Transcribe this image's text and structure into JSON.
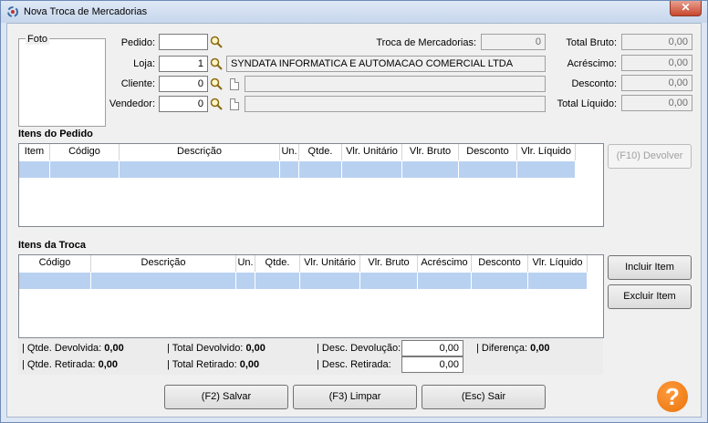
{
  "window": {
    "title": "Nova Troca de Mercadorias",
    "close_label": "✕"
  },
  "foto": {
    "label": "Foto"
  },
  "fields": {
    "pedido": {
      "label": "Pedido:",
      "value": ""
    },
    "loja": {
      "label": "Loja:",
      "value": "1",
      "name": "SYNDATA INFORMATICA E AUTOMACAO COMERCIAL LTDA"
    },
    "cliente": {
      "label": "Cliente:",
      "value": "0",
      "name": ""
    },
    "vendedor": {
      "label": "Vendedor:",
      "value": "0",
      "name": ""
    },
    "troca": {
      "label": "Troca de Mercadorias:",
      "value": "0"
    },
    "total_bruto": {
      "label": "Total Bruto:",
      "value": "0,00"
    },
    "acrescimo": {
      "label": "Acréscimo:",
      "value": "0,00"
    },
    "desconto": {
      "label": "Desconto:",
      "value": "0,00"
    },
    "total_liquido": {
      "label": "Total Líquido:",
      "value": "0,00"
    }
  },
  "itens_pedido": {
    "title": "Itens do Pedido",
    "columns": [
      "Item",
      "Código",
      "Descrição",
      "Un.",
      "Qtde.",
      "Vlr. Unitário",
      "Vlr. Bruto",
      "Desconto",
      "Vlr. Líquido"
    ],
    "devolver_label": "(F10) Devolver"
  },
  "itens_troca": {
    "title": "Itens da Troca",
    "columns": [
      "Código",
      "Descrição",
      "Un.",
      "Qtde.",
      "Vlr. Unitário",
      "Vlr. Bruto",
      "Acréscimo",
      "Desconto",
      "Vlr. Líquido"
    ],
    "incluir_label": "Incluir Item",
    "excluir_label": "Excluir Item"
  },
  "summary": {
    "qtde_devolvida_label": "| Qtde. Devolvida:",
    "qtde_devolvida": "0,00",
    "total_devolvido_label": "| Total Devolvido:",
    "total_devolvido": "0,00",
    "desc_devolucao_label": "| Desc. Devolução:",
    "desc_devolucao": "0,00",
    "diferenca_label": "| Diferença:",
    "diferenca": "0,00",
    "qtde_retirada_label": "| Qtde. Retirada:",
    "qtde_retirada": "0,00",
    "total_retirado_label": "| Total Retirado:",
    "total_retirado": "0,00",
    "desc_retirada_label": "| Desc. Retirada:",
    "desc_retirada": "0,00"
  },
  "buttons": {
    "salvar": "(F2) Salvar",
    "limpar": "(F3) Limpar",
    "sair": "(Esc) Sair"
  },
  "help": {
    "label": "?"
  }
}
